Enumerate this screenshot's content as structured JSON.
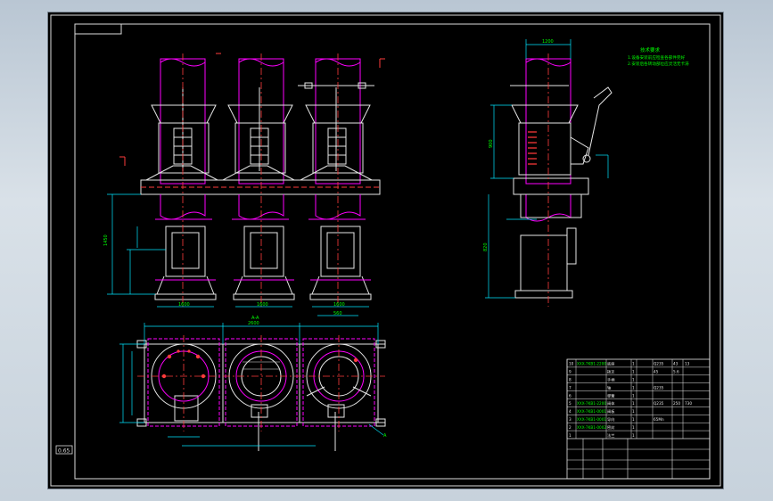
{
  "drawing": {
    "note_title": "技术要求",
    "note_lines": [
      "1.设备安装前应检查各部件完好",
      "2.安装后各转动部位应灵活无卡滞"
    ],
    "section_label": "A-A",
    "side_label": "A",
    "corner_tag": "0.65",
    "dims": {
      "top_width": "1200",
      "height_total": "1450",
      "flange_width": "1600",
      "pipe_dia": "560",
      "bottom_width": "2600",
      "side_height": "900",
      "side_width": "820"
    }
  },
  "title_block": {
    "rows": [
      {
        "no": "10",
        "code": "XXX-7KB1-2200",
        "name": "底座",
        "qty": "1",
        "mat": "Q235",
        "w1": "43",
        "w2": "13"
      },
      {
        "no": "9",
        "code": "",
        "name": "拨叉",
        "qty": "1",
        "mat": "45",
        "w1": "5.6",
        "w2": ""
      },
      {
        "no": "8",
        "code": "",
        "name": "手柄",
        "qty": "1",
        "mat": "",
        "w1": "",
        "w2": ""
      },
      {
        "no": "7",
        "code": "",
        "name": "轴",
        "qty": "1",
        "mat": "Q235",
        "w1": "",
        "w2": ""
      },
      {
        "no": "6",
        "code": "",
        "name": "弹簧",
        "qty": "1",
        "mat": "",
        "w1": "",
        "w2": ""
      },
      {
        "no": "5",
        "code": "XXX-7KB1-2200",
        "name": "阀体",
        "qty": "1",
        "mat": "Q235",
        "w1": "250",
        "w2": "730"
      },
      {
        "no": "4",
        "code": "XXX-7KB1-0001",
        "name": "阀板",
        "qty": "1",
        "mat": "",
        "w1": "",
        "w2": ""
      },
      {
        "no": "3",
        "code": "XXX-7KB1-0001",
        "name": "导向",
        "qty": "1",
        "mat": "65Mn",
        "w1": "",
        "w2": ""
      },
      {
        "no": "2",
        "code": "XXX-7KB1-0002",
        "name": "密封",
        "qty": "1",
        "mat": "",
        "w1": "",
        "w2": ""
      },
      {
        "no": "1",
        "code": "",
        "name": "法兰",
        "qty": "1",
        "mat": "",
        "w1": "",
        "w2": ""
      }
    ]
  }
}
